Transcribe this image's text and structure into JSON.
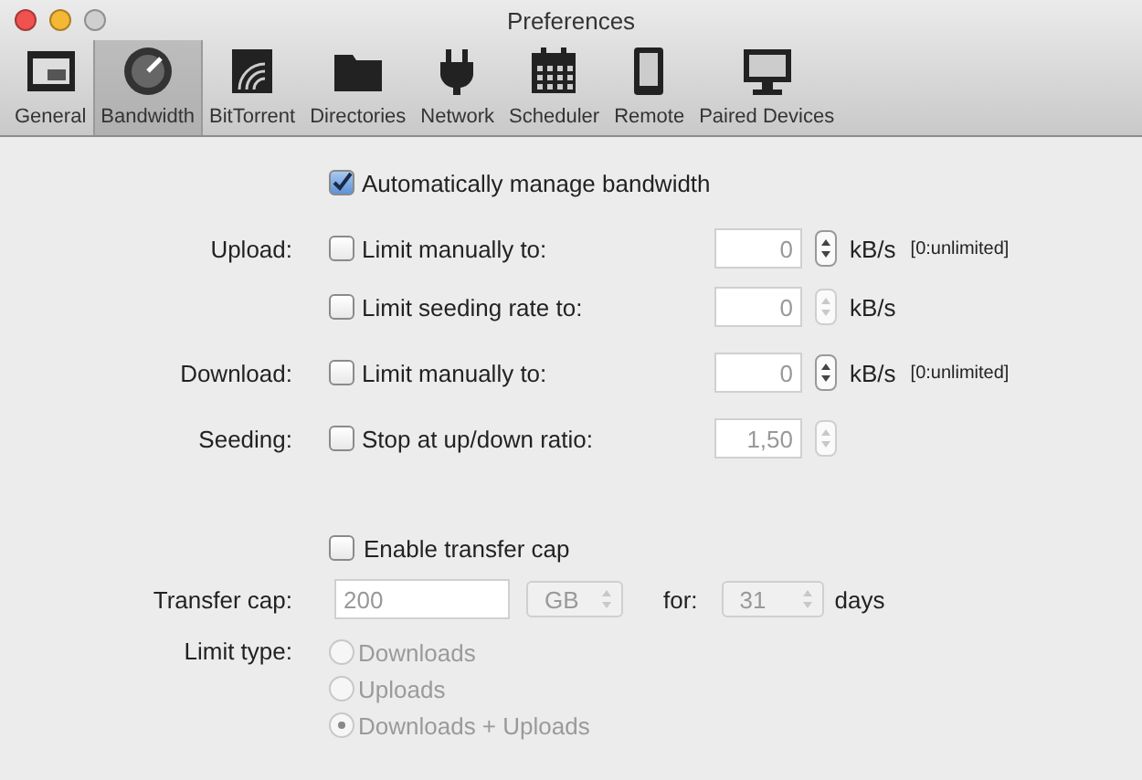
{
  "window": {
    "title": "Preferences"
  },
  "toolbar": {
    "items": [
      {
        "label": "General",
        "selected": false
      },
      {
        "label": "Bandwidth",
        "selected": true
      },
      {
        "label": "BitTorrent",
        "selected": false
      },
      {
        "label": "Directories",
        "selected": false
      },
      {
        "label": "Network",
        "selected": false
      },
      {
        "label": "Scheduler",
        "selected": false
      },
      {
        "label": "Remote",
        "selected": false
      },
      {
        "label": "Paired Devices",
        "selected": false
      }
    ]
  },
  "auto_manage": {
    "label": "Automatically manage bandwidth",
    "checked": true
  },
  "rate_rows": [
    {
      "section_label": "Upload:",
      "label": "Limit manually to:",
      "checked": false,
      "value": "0",
      "stepper_disabled": false,
      "unit": "kB/s",
      "hint": "[0:unlimited]"
    },
    {
      "label": "Limit seeding rate to:",
      "checked": false,
      "value": "0",
      "stepper_disabled": true,
      "unit": "kB/s"
    },
    {
      "section_label": "Download:",
      "label": "Limit manually to:",
      "checked": false,
      "value": "0",
      "stepper_disabled": false,
      "unit": "kB/s",
      "hint": "[0:unlimited]"
    },
    {
      "section_label": "Seeding:",
      "label": "Stop at up/down ratio:",
      "checked": false,
      "value": "1,50",
      "stepper_disabled": true
    }
  ],
  "transfer_cap": {
    "enable": {
      "label": "Enable transfer cap",
      "checked": false
    },
    "label": "Transfer cap:",
    "value": "200",
    "unit": "GB",
    "for_label": "for:",
    "days": "31",
    "days_label": "days"
  },
  "limit_type": {
    "label": "Limit type:",
    "options": [
      {
        "label": "Downloads",
        "selected": false
      },
      {
        "label": "Uploads",
        "selected": false
      },
      {
        "label": "Downloads + Uploads",
        "selected": true
      }
    ]
  }
}
